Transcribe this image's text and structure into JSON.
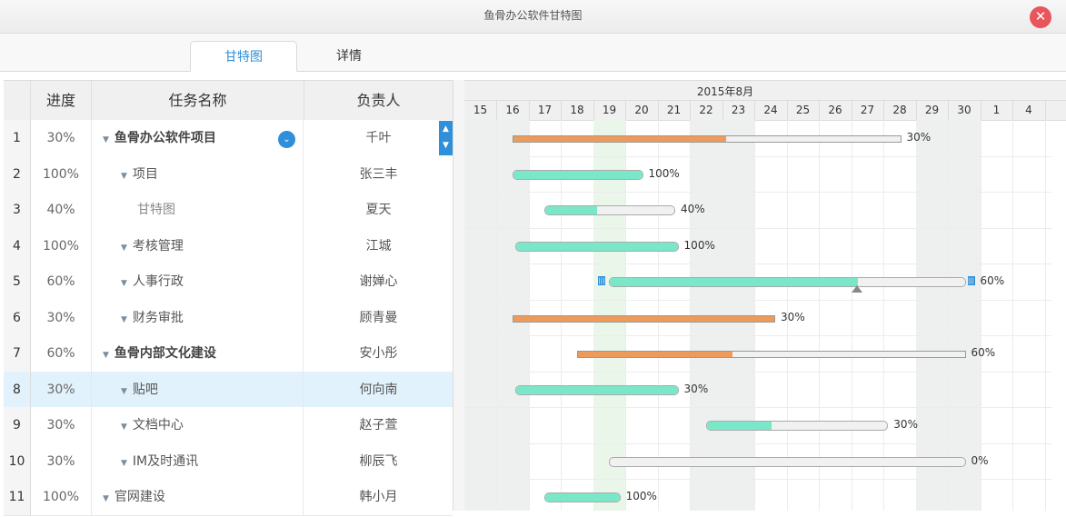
{
  "window": {
    "title": "鱼骨办公软件甘特图"
  },
  "tabs": [
    {
      "label": "甘特图",
      "active": true
    },
    {
      "label": "详情",
      "active": false
    }
  ],
  "grid": {
    "columns": {
      "progress": "进度",
      "name": "任务名称",
      "owner": "负责人"
    },
    "rows": [
      {
        "num": "1",
        "progress": "30%",
        "name": "鱼骨办公软件项目",
        "owner": "千叶",
        "level": 0,
        "bold": true
      },
      {
        "num": "2",
        "progress": "100%",
        "name": "项目",
        "owner": "张三丰",
        "level": 1,
        "bold": false
      },
      {
        "num": "3",
        "progress": "40%",
        "name": "甘特图",
        "owner": "夏天",
        "level": 2,
        "bold": false
      },
      {
        "num": "4",
        "progress": "100%",
        "name": "考核管理",
        "owner": "江城",
        "level": 1,
        "bold": false
      },
      {
        "num": "5",
        "progress": "60%",
        "name": "人事行政",
        "owner": "谢婵心",
        "level": 1,
        "bold": false
      },
      {
        "num": "6",
        "progress": "30%",
        "name": "财务审批",
        "owner": "顾青曼",
        "level": 1,
        "bold": false
      },
      {
        "num": "7",
        "progress": "60%",
        "name": "鱼骨内部文化建设",
        "owner": "安小彤",
        "level": 0,
        "bold": true
      },
      {
        "num": "8",
        "progress": "30%",
        "name": "贴吧",
        "owner": "何向南",
        "level": 1,
        "bold": false
      },
      {
        "num": "9",
        "progress": "30%",
        "name": "文档中心",
        "owner": "赵子萱",
        "level": 1,
        "bold": false
      },
      {
        "num": "10",
        "progress": "30%",
        "name": "IM及时通讯",
        "owner": "柳辰飞",
        "level": 1,
        "bold": false
      },
      {
        "num": "11",
        "progress": "100%",
        "name": "官网建设",
        "owner": "韩小月",
        "level": 0,
        "bold": false
      }
    ]
  },
  "gantt": {
    "month": "2015年8月",
    "days": [
      "15",
      "16",
      "17",
      "18",
      "19",
      "20",
      "21",
      "22",
      "23",
      "24",
      "25",
      "26",
      "27",
      "28",
      "29",
      "30",
      "1",
      "4"
    ],
    "bars": [
      {
        "row": 0,
        "start": 16,
        "end": 28.0,
        "progress": 0.55,
        "type": "summary",
        "label": "30%"
      },
      {
        "row": 1,
        "start": 16,
        "end": 20,
        "progress": 1.0,
        "type": "task",
        "label": "100%"
      },
      {
        "row": 2,
        "start": 17,
        "end": 21,
        "progress": 0.4,
        "type": "task",
        "label": "40%"
      },
      {
        "row": 3,
        "start": 16.1,
        "end": 21.1,
        "progress": 1.0,
        "type": "task",
        "label": "100%"
      },
      {
        "row": 4,
        "start": 19,
        "end": 30.0,
        "progress": 0.7,
        "type": "task",
        "label": "60%"
      },
      {
        "row": 5,
        "start": 16,
        "end": 24.1,
        "progress": 1.0,
        "type": "summary",
        "label": "30%"
      },
      {
        "row": 6,
        "start": 18,
        "end": 30.0,
        "progress": 0.4,
        "type": "summary",
        "label": "60%"
      },
      {
        "row": 7,
        "start": 16.1,
        "end": 21.1,
        "progress": 1.0,
        "type": "task",
        "label": "30%"
      },
      {
        "row": 8,
        "start": 22,
        "end": 27.6,
        "progress": 0.36,
        "type": "task",
        "label": "30%"
      },
      {
        "row": 9,
        "start": 19,
        "end": 30.0,
        "progress": 0.0,
        "type": "task",
        "label": "0%"
      },
      {
        "row": 10,
        "start": 17,
        "end": 19.3,
        "progress": 1.0,
        "type": "task",
        "label": "100%"
      }
    ]
  },
  "colors": {
    "accent": "#2f8fd8",
    "task_fill": "#7ae8c8",
    "summary_fill": "#ee9a5a",
    "close": "#e8555c"
  }
}
